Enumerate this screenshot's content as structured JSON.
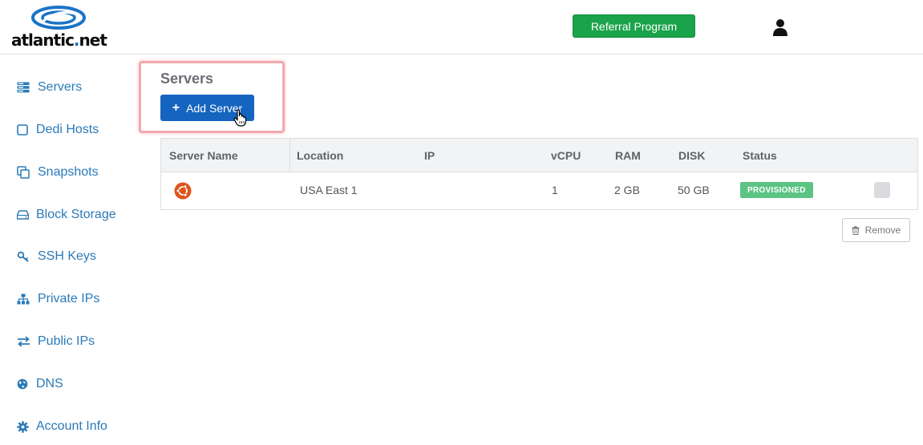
{
  "header": {
    "logo_text_main": "atlantic",
    "logo_text_dot": ".",
    "logo_text_tld": "net",
    "referral_label": "Referral Program",
    "user_icon": "user-icon"
  },
  "sidebar": {
    "items": [
      {
        "label": "Servers",
        "icon": "server-icon"
      },
      {
        "label": "Dedi Hosts",
        "icon": "square-icon"
      },
      {
        "label": "Snapshots",
        "icon": "copy-icon"
      },
      {
        "label": "Block Storage",
        "icon": "drive-icon"
      },
      {
        "label": "SSH Keys",
        "icon": "key-icon"
      },
      {
        "label": "Private IPs",
        "icon": "sitemap-icon"
      },
      {
        "label": "Public IPs",
        "icon": "exchange-icon"
      },
      {
        "label": "DNS",
        "icon": "globe-icon"
      },
      {
        "label": "Account Info",
        "icon": "gear-icon"
      }
    ]
  },
  "main": {
    "title": "Servers",
    "add_label": "Add Server",
    "remove_label": "Remove",
    "table": {
      "headers": [
        "Server Name",
        "Location",
        "IP",
        "vCPU",
        "RAM",
        "DISK",
        "Status"
      ],
      "rows": [
        {
          "name": "",
          "location": "USA East 1",
          "ip": "",
          "vcpu": "1",
          "ram": "2 GB",
          "disk": "50 GB",
          "status": "PROVISIONED",
          "os_icon": "ubuntu-icon"
        }
      ]
    }
  },
  "colors": {
    "accent": "#1565c0",
    "referral": "#1aa34a",
    "status_ok": "#5cc483",
    "link": "#2a7ab8"
  }
}
